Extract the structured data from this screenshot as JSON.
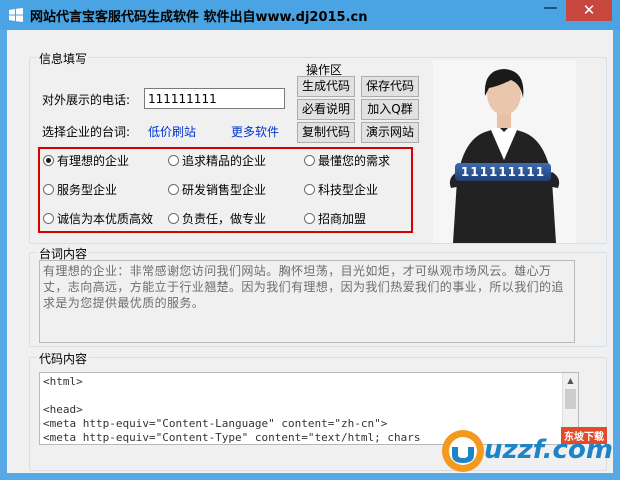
{
  "window": {
    "title": "网站代言宝客服代码生成软件  软件出自www.dj2015.cn",
    "minimize_glyph": "—",
    "close_glyph": "✕"
  },
  "info": {
    "legend": "信息填写",
    "phone_label": "对外展示的电话:",
    "phone_value": "111111111",
    "slogan_label": "选择企业的台词:",
    "link_cheap": "低价刷站",
    "link_more": "更多软件"
  },
  "ops": {
    "legend": "操作区",
    "buttons": [
      "生成代码",
      "保存代码",
      "必看说明",
      "加入Q群",
      "复制代码",
      "演示网站"
    ]
  },
  "radios": [
    {
      "label": "有理想的企业",
      "checked": true
    },
    {
      "label": "追求精品的企业",
      "checked": false
    },
    {
      "label": "最懂您的需求",
      "checked": false
    },
    {
      "label": "服务型企业",
      "checked": false
    },
    {
      "label": "研发销售型企业",
      "checked": false
    },
    {
      "label": "科技型企业",
      "checked": false
    },
    {
      "label": "诚信为本优质高效",
      "checked": false
    },
    {
      "label": "负责任，做专业",
      "checked": false
    },
    {
      "label": "招商加盟",
      "checked": false
    }
  ],
  "photo": {
    "badge": "111111111"
  },
  "slogan": {
    "legend": "台词内容",
    "text": "有理想的企业：非常感谢您访问我们网站。胸怀坦荡，目光如炬，才可纵观市场风云。雄心万丈，志向高远，方能立于行业翘楚。因为我们有理想，因为我们热爱我们的事业，所以我们的追求是为您提供最优质的服务。"
  },
  "code": {
    "legend": "代码内容",
    "text": "<html>\n\n<head>\n<meta http-equiv=\"Content-Language\" content=\"zh-cn\">\n<meta http-equiv=\"Content-Type\" content=\"text/html; chars"
  },
  "watermark": {
    "text": "uzzf.com",
    "tag": "东坡下载"
  },
  "colors": {
    "accent_red": "#d90000",
    "title_bar": "#4aa3e2",
    "close_button": "#c7473e",
    "link": "#0033cc"
  }
}
